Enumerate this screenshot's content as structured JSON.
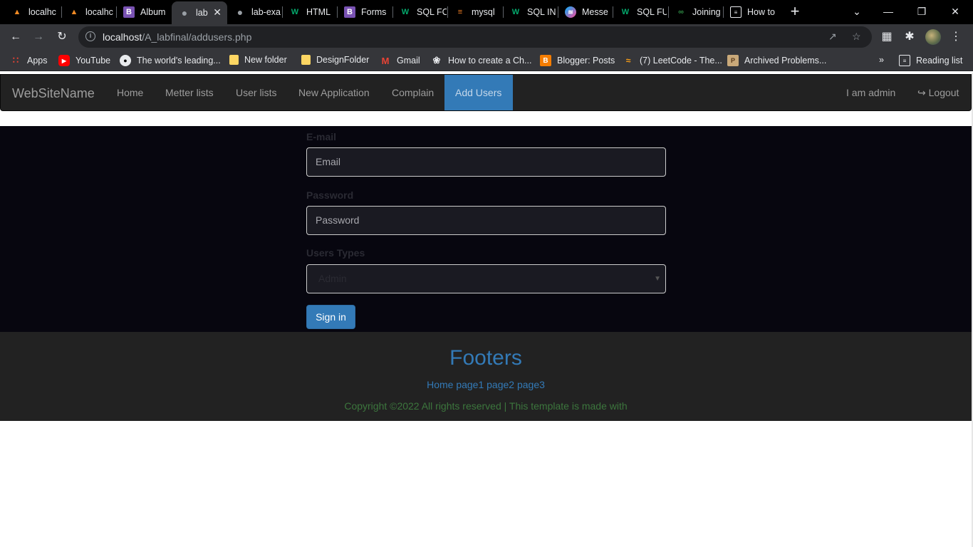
{
  "tabs": [
    {
      "title": "localhc",
      "icon": "xampp-icon"
    },
    {
      "title": "localhc",
      "icon": "xampp-icon"
    },
    {
      "title": "Album",
      "icon": "bootstrap-icon"
    },
    {
      "title": "lab",
      "icon": "globe-icon",
      "active": true
    },
    {
      "title": "lab-exa",
      "icon": "globe-icon"
    },
    {
      "title": "HTML",
      "icon": "w3schools-icon"
    },
    {
      "title": "Forms",
      "icon": "bootstrap-icon"
    },
    {
      "title": "SQL FC",
      "icon": "w3schools-icon"
    },
    {
      "title": "mysql",
      "icon": "stackoverflow-icon"
    },
    {
      "title": "SQL IN",
      "icon": "w3schools-icon"
    },
    {
      "title": "Messe",
      "icon": "messenger-icon"
    },
    {
      "title": "SQL FU",
      "icon": "w3schools-icon"
    },
    {
      "title": "Joining",
      "icon": "geeksforgeeks-icon"
    },
    {
      "title": "How to",
      "icon": "page-icon"
    }
  ],
  "address": {
    "host": "localhost",
    "path": "/A_labfinal/addusers.php"
  },
  "bookmarks": [
    {
      "label": "Apps",
      "icon": "apps-grid-icon"
    },
    {
      "label": "YouTube",
      "icon": "youtube-icon"
    },
    {
      "label": "The world's leading...",
      "icon": "github-icon"
    },
    {
      "label": "New folder",
      "icon": "folder-icon"
    },
    {
      "label": "DesignFolder",
      "icon": "folder-icon"
    },
    {
      "label": "Gmail",
      "icon": "gmail-icon"
    },
    {
      "label": "How to create a Ch...",
      "icon": "chatgpt-like-icon"
    },
    {
      "label": "Blogger: Posts",
      "icon": "blogger-icon"
    },
    {
      "label": "(7) LeetCode - The...",
      "icon": "leetcode-icon"
    },
    {
      "label": "Archived Problems...",
      "icon": "archive-icon"
    }
  ],
  "reading_list": "Reading list",
  "more_bookmarks": "»",
  "navbar": {
    "brand": "WebSiteName",
    "links": [
      "Home",
      "Metter lists",
      "User lists",
      "New Application",
      "Complain",
      "Add Users"
    ],
    "active": "Add Users",
    "user": "I am admin",
    "logout": "Logout"
  },
  "form": {
    "email_label": "E-mail",
    "email_placeholder": "Email",
    "password_label": "Password",
    "password_placeholder": "Password",
    "type_label": "Users Types",
    "type_selected": "Admin",
    "submit": "Sign in"
  },
  "footer": {
    "title": "Footers",
    "links": "Home page1 page2 page3",
    "copyright": "Copyright ©2022 All rights reserved | This template is made with"
  },
  "colors": {
    "primary": "#337ab7",
    "navbar": "#222222",
    "content_bg": "#07060f",
    "copyright": "#3c763d"
  }
}
